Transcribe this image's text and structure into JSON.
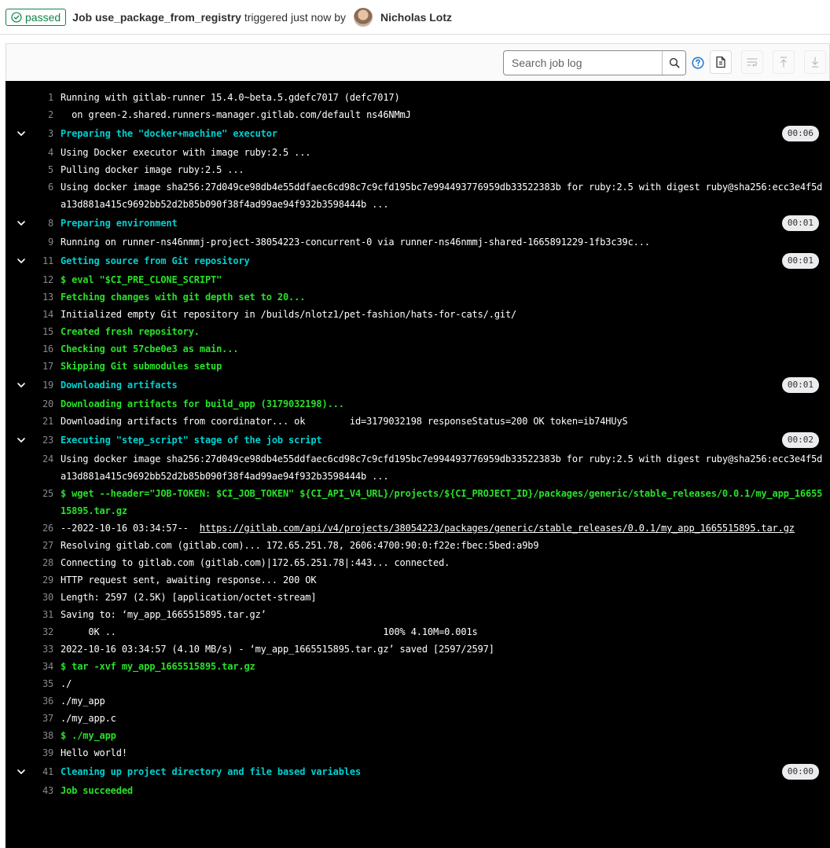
{
  "header": {
    "status_label": "passed",
    "job_prefix": "Job ",
    "job_name": "use_package_from_registry",
    "meta_text": " triggered just now by",
    "user_name": "Nicholas Lotz"
  },
  "toolbar": {
    "search_placeholder": "Search job log",
    "icons": [
      "search-icon",
      "question-icon",
      "raw-log-icon",
      "wrap-icon",
      "scroll-top-icon",
      "scroll-bottom-icon"
    ]
  },
  "colors": {
    "success": "#108548",
    "section": "#00d1d1",
    "command": "#28e128",
    "log_bg": "#000000"
  },
  "log": {
    "lines": [
      {
        "n": "1",
        "text": "Running with gitlab-runner 15.4.0~beta.5.gdefc7017 (defc7017)",
        "type": "plain"
      },
      {
        "n": "2",
        "text": "  on green-2.shared.runners-manager.gitlab.com/default ns46NMmJ",
        "type": "plain"
      },
      {
        "n": "3",
        "text": "Preparing the \"docker+machine\" executor",
        "type": "section",
        "duration": "00:06"
      },
      {
        "n": "4",
        "text": "Using Docker executor with image ruby:2.5 ...",
        "type": "plain"
      },
      {
        "n": "5",
        "text": "Pulling docker image ruby:2.5 ...",
        "type": "plain"
      },
      {
        "n": "6",
        "text": "Using docker image sha256:27d049ce98db4e55ddfaec6cd98c7c9cfd195bc7e994493776959db33522383b for ruby:2.5 with digest ruby@sha256:ecc3e4f5da13d881a415c9692bb52d2b85b090f38f4ad99ae94f932b3598444b ...",
        "type": "plain"
      },
      {
        "n": "8",
        "text": "Preparing environment",
        "type": "section",
        "duration": "00:01"
      },
      {
        "n": "9",
        "text": "Running on runner-ns46nmmj-project-38054223-concurrent-0 via runner-ns46nmmj-shared-1665891229-1fb3c39c...",
        "type": "plain"
      },
      {
        "n": "11",
        "text": "Getting source from Git repository",
        "type": "section",
        "duration": "00:01"
      },
      {
        "n": "12",
        "text": "$ eval \"$CI_PRE_CLONE_SCRIPT\"",
        "type": "command"
      },
      {
        "n": "13",
        "text": "Fetching changes with git depth set to 20...",
        "type": "command"
      },
      {
        "n": "14",
        "text": "Initialized empty Git repository in /builds/nlotz1/pet-fashion/hats-for-cats/.git/",
        "type": "plain"
      },
      {
        "n": "15",
        "text": "Created fresh repository.",
        "type": "command"
      },
      {
        "n": "16",
        "text": "Checking out 57cbe0e3 as main...",
        "type": "command"
      },
      {
        "n": "17",
        "text": "Skipping Git submodules setup",
        "type": "command"
      },
      {
        "n": "19",
        "text": "Downloading artifacts",
        "type": "section",
        "duration": "00:01"
      },
      {
        "n": "20",
        "text": "Downloading artifacts for build_app (3179032198)...",
        "type": "command"
      },
      {
        "n": "21",
        "text": "Downloading artifacts from coordinator... ok        id=3179032198 responseStatus=200 OK token=ib74HUyS",
        "type": "plain"
      },
      {
        "n": "23",
        "text": "Executing \"step_script\" stage of the job script",
        "type": "section",
        "duration": "00:02"
      },
      {
        "n": "24",
        "text": "Using docker image sha256:27d049ce98db4e55ddfaec6cd98c7c9cfd195bc7e994493776959db33522383b for ruby:2.5 with digest ruby@sha256:ecc3e4f5da13d881a415c9692bb52d2b85b090f38f4ad99ae94f932b3598444b ...",
        "type": "plain"
      },
      {
        "n": "25",
        "text": "$ wget --header=\"JOB-TOKEN: $CI_JOB_TOKEN\" ${CI_API_V4_URL}/projects/${CI_PROJECT_ID}/packages/generic/stable_releases/0.0.1/my_app_1665515895.tar.gz",
        "type": "command"
      },
      {
        "n": "26",
        "text": "--2022-10-16 03:34:57--  ",
        "link": "https://gitlab.com/api/v4/projects/38054223/packages/generic/stable_releases/0.0.1/my_app_1665515895.tar.gz",
        "type": "link"
      },
      {
        "n": "27",
        "text": "Resolving gitlab.com (gitlab.com)... 172.65.251.78, 2606:4700:90:0:f22e:fbec:5bed:a9b9",
        "type": "plain"
      },
      {
        "n": "28",
        "text": "Connecting to gitlab.com (gitlab.com)|172.65.251.78|:443... connected.",
        "type": "plain"
      },
      {
        "n": "29",
        "text": "HTTP request sent, awaiting response... 200 OK",
        "type": "plain"
      },
      {
        "n": "30",
        "text": "Length: 2597 (2.5K) [application/octet-stream]",
        "type": "plain"
      },
      {
        "n": "31",
        "text": "Saving to: ‘my_app_1665515895.tar.gz’",
        "type": "plain"
      },
      {
        "n": "32",
        "text": "     0K ..                                                100% 4.10M=0.001s",
        "type": "plain"
      },
      {
        "n": "33",
        "text": "2022-10-16 03:34:57 (4.10 MB/s) - ‘my_app_1665515895.tar.gz’ saved [2597/2597]",
        "type": "plain"
      },
      {
        "n": "34",
        "text": "$ tar -xvf my_app_1665515895.tar.gz",
        "type": "command"
      },
      {
        "n": "35",
        "text": "./",
        "type": "plain"
      },
      {
        "n": "36",
        "text": "./my_app",
        "type": "plain"
      },
      {
        "n": "37",
        "text": "./my_app.c",
        "type": "plain"
      },
      {
        "n": "38",
        "text": "$ ./my_app",
        "type": "command"
      },
      {
        "n": "39",
        "text": "Hello world!",
        "type": "plain"
      },
      {
        "n": "41",
        "text": "Cleaning up project directory and file based variables",
        "type": "section",
        "duration": "00:00"
      },
      {
        "n": "43",
        "text": "Job succeeded",
        "type": "command"
      }
    ]
  }
}
